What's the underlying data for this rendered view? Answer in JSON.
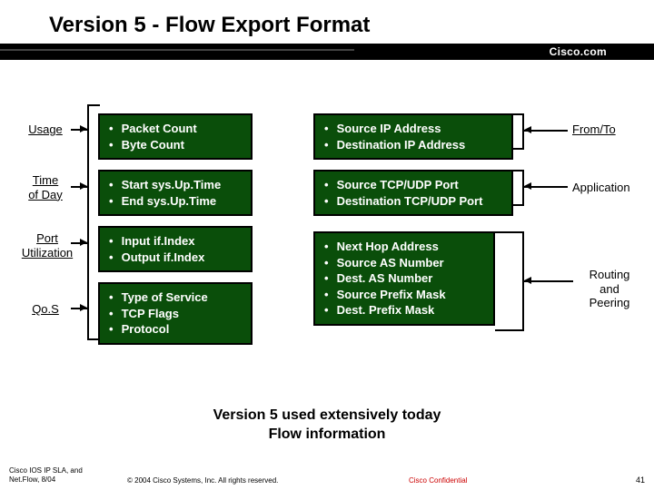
{
  "title": "Version 5 - Flow Export Format",
  "cisco": "Cisco.com",
  "leftBoxes": {
    "usage": [
      "Packet Count",
      "Byte Count"
    ],
    "time": [
      "Start sys.Up.Time",
      "End sys.Up.Time"
    ],
    "port": [
      "Input if.Index",
      "Output if.Index"
    ],
    "qos": [
      "Type of Service",
      "TCP Flags",
      "Protocol"
    ]
  },
  "rightBoxes": {
    "fromto": [
      "Source IP Address",
      "Destination IP Address"
    ],
    "app": [
      "Source TCP/UDP Port",
      "Destination TCP/UDP Port"
    ],
    "routing": [
      "Next Hop Address",
      "Source AS Number",
      "Dest. AS Number",
      "Source Prefix Mask",
      "Dest. Prefix Mask"
    ]
  },
  "labels": {
    "usage": "Usage",
    "time_l1": "Time",
    "time_l2": "of Day",
    "port_l1": "Port",
    "port_l2": "Utilization",
    "qos": "Qo.S",
    "fromto": "From/To",
    "app": "Application",
    "routing_l1": "Routing",
    "routing_l2": "and",
    "routing_l3": "Peering"
  },
  "caption_l1": "Version 5 used extensively today",
  "caption_l2": "Flow information",
  "footer": {
    "product_l1": "Cisco IOS IP SLA, and",
    "product_l2": "Net.Flow, 8/04",
    "copyright": "© 2004 Cisco Systems, Inc. All rights reserved.",
    "confidential": "Cisco Confidential",
    "page": "41"
  }
}
